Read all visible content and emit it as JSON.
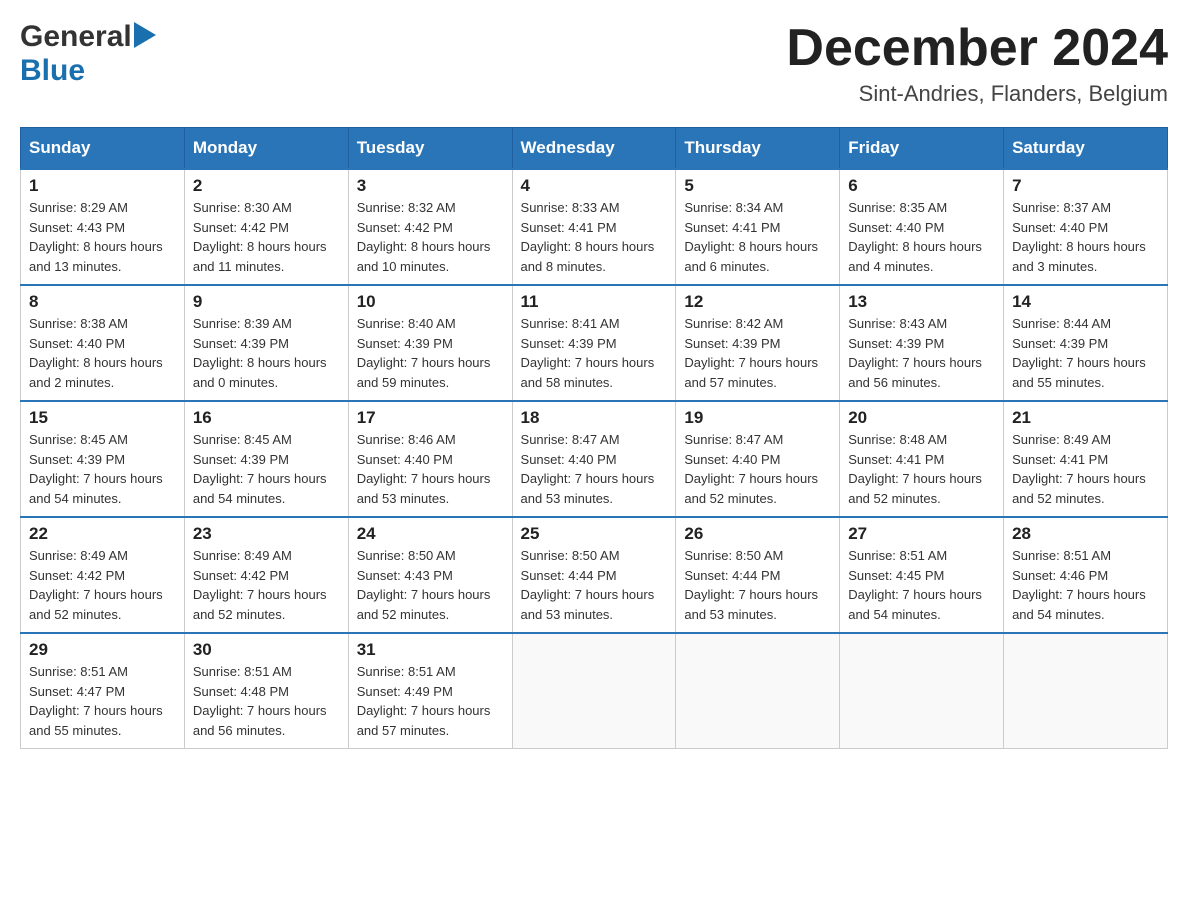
{
  "header": {
    "logo_general": "General",
    "logo_blue": "Blue",
    "month_title": "December 2024",
    "location": "Sint-Andries, Flanders, Belgium"
  },
  "weekdays": [
    "Sunday",
    "Monday",
    "Tuesday",
    "Wednesday",
    "Thursday",
    "Friday",
    "Saturday"
  ],
  "weeks": [
    [
      {
        "day": "1",
        "sunrise": "8:29 AM",
        "sunset": "4:43 PM",
        "daylight": "8 hours and 13 minutes."
      },
      {
        "day": "2",
        "sunrise": "8:30 AM",
        "sunset": "4:42 PM",
        "daylight": "8 hours and 11 minutes."
      },
      {
        "day": "3",
        "sunrise": "8:32 AM",
        "sunset": "4:42 PM",
        "daylight": "8 hours and 10 minutes."
      },
      {
        "day": "4",
        "sunrise": "8:33 AM",
        "sunset": "4:41 PM",
        "daylight": "8 hours and 8 minutes."
      },
      {
        "day": "5",
        "sunrise": "8:34 AM",
        "sunset": "4:41 PM",
        "daylight": "8 hours and 6 minutes."
      },
      {
        "day": "6",
        "sunrise": "8:35 AM",
        "sunset": "4:40 PM",
        "daylight": "8 hours and 4 minutes."
      },
      {
        "day": "7",
        "sunrise": "8:37 AM",
        "sunset": "4:40 PM",
        "daylight": "8 hours and 3 minutes."
      }
    ],
    [
      {
        "day": "8",
        "sunrise": "8:38 AM",
        "sunset": "4:40 PM",
        "daylight": "8 hours and 2 minutes."
      },
      {
        "day": "9",
        "sunrise": "8:39 AM",
        "sunset": "4:39 PM",
        "daylight": "8 hours and 0 minutes."
      },
      {
        "day": "10",
        "sunrise": "8:40 AM",
        "sunset": "4:39 PM",
        "daylight": "7 hours and 59 minutes."
      },
      {
        "day": "11",
        "sunrise": "8:41 AM",
        "sunset": "4:39 PM",
        "daylight": "7 hours and 58 minutes."
      },
      {
        "day": "12",
        "sunrise": "8:42 AM",
        "sunset": "4:39 PM",
        "daylight": "7 hours and 57 minutes."
      },
      {
        "day": "13",
        "sunrise": "8:43 AM",
        "sunset": "4:39 PM",
        "daylight": "7 hours and 56 minutes."
      },
      {
        "day": "14",
        "sunrise": "8:44 AM",
        "sunset": "4:39 PM",
        "daylight": "7 hours and 55 minutes."
      }
    ],
    [
      {
        "day": "15",
        "sunrise": "8:45 AM",
        "sunset": "4:39 PM",
        "daylight": "7 hours and 54 minutes."
      },
      {
        "day": "16",
        "sunrise": "8:45 AM",
        "sunset": "4:39 PM",
        "daylight": "7 hours and 54 minutes."
      },
      {
        "day": "17",
        "sunrise": "8:46 AM",
        "sunset": "4:40 PM",
        "daylight": "7 hours and 53 minutes."
      },
      {
        "day": "18",
        "sunrise": "8:47 AM",
        "sunset": "4:40 PM",
        "daylight": "7 hours and 53 minutes."
      },
      {
        "day": "19",
        "sunrise": "8:47 AM",
        "sunset": "4:40 PM",
        "daylight": "7 hours and 52 minutes."
      },
      {
        "day": "20",
        "sunrise": "8:48 AM",
        "sunset": "4:41 PM",
        "daylight": "7 hours and 52 minutes."
      },
      {
        "day": "21",
        "sunrise": "8:49 AM",
        "sunset": "4:41 PM",
        "daylight": "7 hours and 52 minutes."
      }
    ],
    [
      {
        "day": "22",
        "sunrise": "8:49 AM",
        "sunset": "4:42 PM",
        "daylight": "7 hours and 52 minutes."
      },
      {
        "day": "23",
        "sunrise": "8:49 AM",
        "sunset": "4:42 PM",
        "daylight": "7 hours and 52 minutes."
      },
      {
        "day": "24",
        "sunrise": "8:50 AM",
        "sunset": "4:43 PM",
        "daylight": "7 hours and 52 minutes."
      },
      {
        "day": "25",
        "sunrise": "8:50 AM",
        "sunset": "4:44 PM",
        "daylight": "7 hours and 53 minutes."
      },
      {
        "day": "26",
        "sunrise": "8:50 AM",
        "sunset": "4:44 PM",
        "daylight": "7 hours and 53 minutes."
      },
      {
        "day": "27",
        "sunrise": "8:51 AM",
        "sunset": "4:45 PM",
        "daylight": "7 hours and 54 minutes."
      },
      {
        "day": "28",
        "sunrise": "8:51 AM",
        "sunset": "4:46 PM",
        "daylight": "7 hours and 54 minutes."
      }
    ],
    [
      {
        "day": "29",
        "sunrise": "8:51 AM",
        "sunset": "4:47 PM",
        "daylight": "7 hours and 55 minutes."
      },
      {
        "day": "30",
        "sunrise": "8:51 AM",
        "sunset": "4:48 PM",
        "daylight": "7 hours and 56 minutes."
      },
      {
        "day": "31",
        "sunrise": "8:51 AM",
        "sunset": "4:49 PM",
        "daylight": "7 hours and 57 minutes."
      },
      null,
      null,
      null,
      null
    ]
  ],
  "labels": {
    "sunrise": "Sunrise:",
    "sunset": "Sunset:",
    "daylight": "Daylight:"
  }
}
